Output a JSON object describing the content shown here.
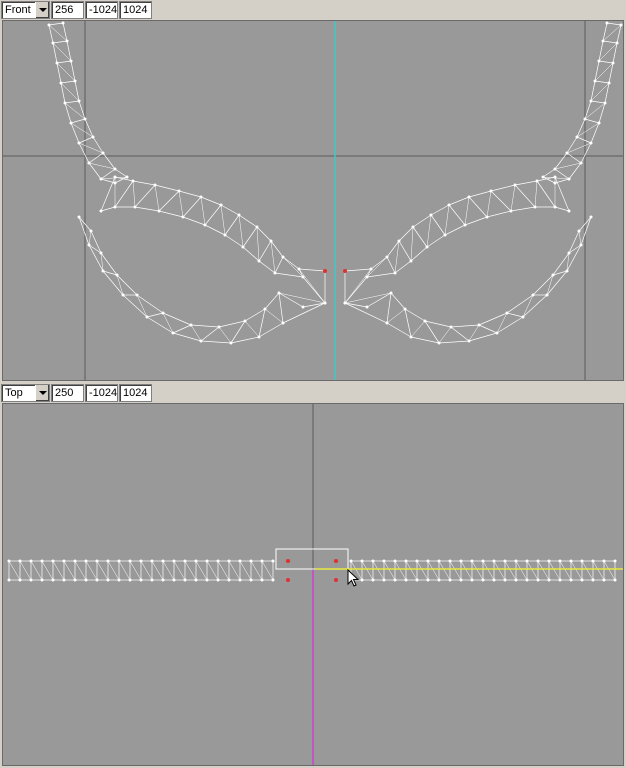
{
  "front_view": {
    "view_select": "Front",
    "fields": [
      "256",
      "-1024",
      "1024"
    ]
  },
  "top_view": {
    "view_select": "Top",
    "fields": [
      "250",
      "-1024",
      "1024"
    ]
  },
  "colors": {
    "background": "#999999",
    "grid": "#5a5a5a",
    "wireframe": "#ffffff",
    "selected_vertex": "#e03030",
    "axis_front": "#40c8c8",
    "axis_top": "#d040d0",
    "highlight_edge": "#e8e840"
  },
  "icons": [
    "dropdown-arrow-icon",
    "mouse-cursor-icon"
  ]
}
